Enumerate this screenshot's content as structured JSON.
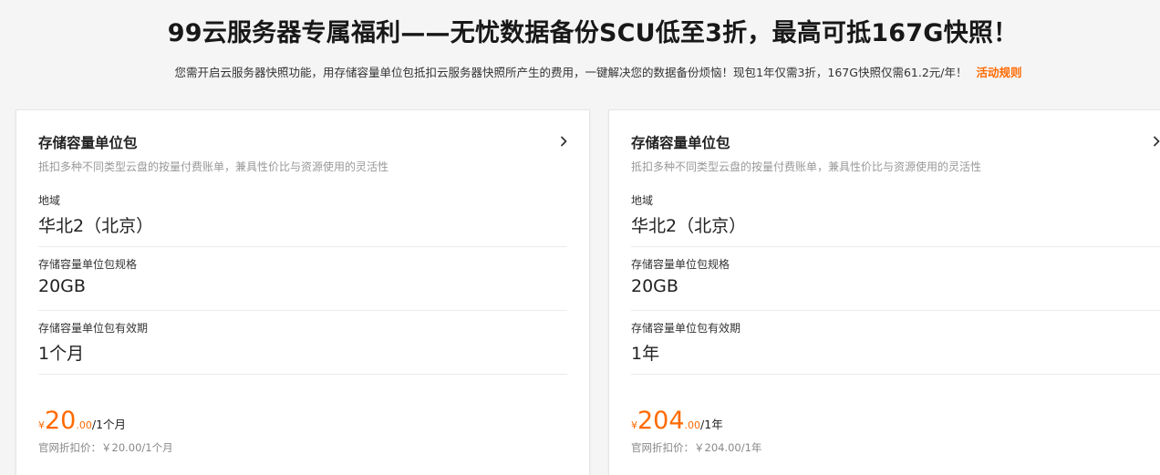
{
  "hero": {
    "title": "99云服务器专属福利——无忧数据备份SCU低至3折，最高可抵167G快照！",
    "description": "您需开启云服务器快照功能，用存储容量单位包抵扣云服务器快照所产生的费用，一键解决您的数据备份烦恼！现包1年仅需3折，167G快照仅需61.2元/年！",
    "rules_link": "活动规则"
  },
  "cards": [
    {
      "title": "存储容量单位包",
      "subtitle": "抵扣多种不同类型云盘的按量付费账单，兼具性价比与资源使用的灵活性",
      "fields": [
        {
          "label": "地域",
          "value": "华北2（北京）"
        },
        {
          "label": "存储容量单位包规格",
          "value": "20GB"
        },
        {
          "label": "存储容量单位包有效期",
          "value": "1个月"
        }
      ],
      "price": {
        "currency": "¥",
        "integer": "20",
        "decimal": ".00",
        "unit": "/1个月"
      },
      "list_price": "官网折扣价：￥20.00/1个月",
      "icon": "chevron-right-icon"
    },
    {
      "title": "存储容量单位包",
      "subtitle": "抵扣多种不同类型云盘的按量付费账单，兼具性价比与资源使用的灵活性",
      "fields": [
        {
          "label": "地域",
          "value": "华北2（北京）"
        },
        {
          "label": "存储容量单位包规格",
          "value": "20GB"
        },
        {
          "label": "存储容量单位包有效期",
          "value": "1年"
        }
      ],
      "price": {
        "currency": "¥",
        "integer": "204",
        "decimal": ".00",
        "unit": "/1年"
      },
      "list_price": "官网折扣价：￥204.00/1年",
      "icon": "chevron-right-icon"
    }
  ],
  "colors": {
    "accent": "#ff6a00",
    "background": "#f5f5f6",
    "card": "#ffffff"
  }
}
